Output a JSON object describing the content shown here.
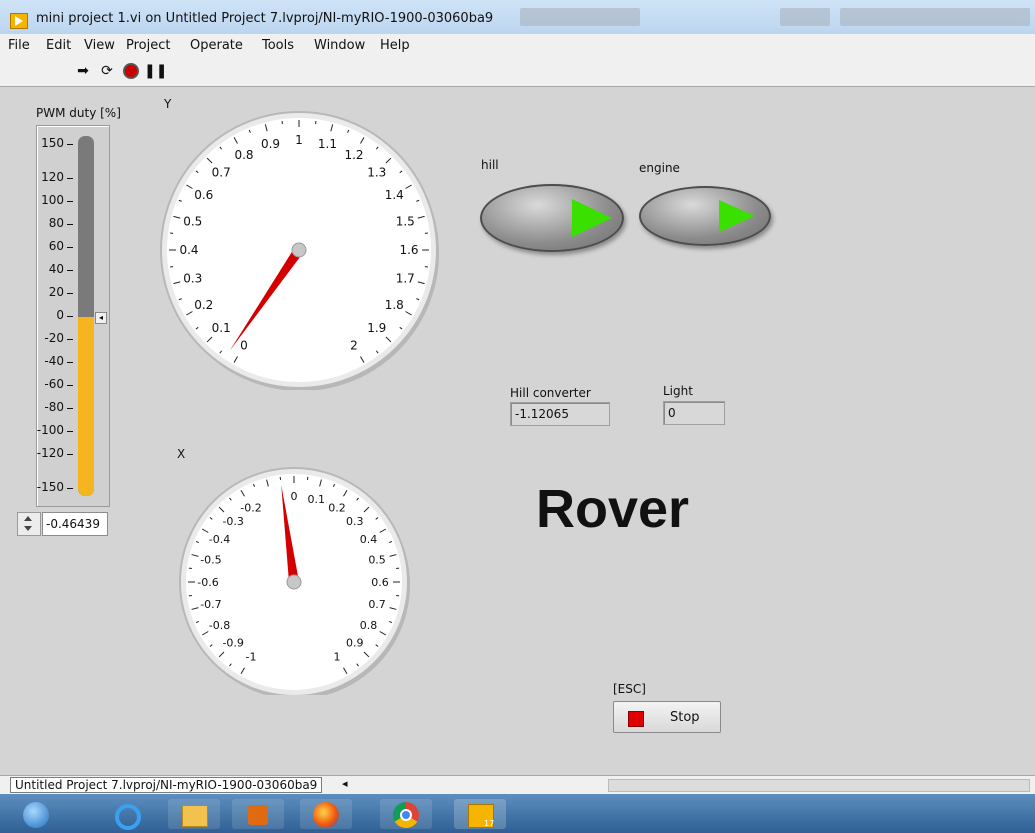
{
  "window": {
    "title": "mini project 1.vi on Untitled Project 7.lvproj/NI-myRIO-1900-03060ba9"
  },
  "menu": [
    "File",
    "Edit",
    "View",
    "Project",
    "Operate",
    "Tools",
    "Window",
    "Help"
  ],
  "toolbar": {
    "icons": [
      "run-arrow-icon",
      "run-continuous-icon",
      "abort-icon",
      "pause-icon"
    ]
  },
  "pwm": {
    "label": "PWM duty  [%]",
    "ticks": [
      "150",
      "120",
      "100",
      "80",
      "60",
      "40",
      "20",
      "0",
      "-20",
      "-40",
      "-60",
      "-80",
      "-100",
      "-120",
      "-150"
    ],
    "value_display": "-0.46439",
    "value": -0.46439,
    "min": -150,
    "max": 150
  },
  "gauge_y": {
    "label": "Y",
    "ticks": [
      "0",
      "0.1",
      "0.2",
      "0.3",
      "0.4",
      "0.5",
      "0.6",
      "0.7",
      "0.8",
      "0.9",
      "1",
      "1.1",
      "1.2",
      "1.3",
      "1.4",
      "1.5",
      "1.6",
      "1.7",
      "1.8",
      "1.9",
      "2"
    ],
    "min": 0,
    "max": 2,
    "value": 0.03
  },
  "gauge_x": {
    "label": "X",
    "ticks": [
      "-1",
      "-0.9",
      "-0.8",
      "-0.7",
      "-0.6",
      "-0.5",
      "-0.4",
      "-0.3",
      "-0.2",
      "0",
      "0.1",
      "0.2",
      "0.3",
      "0.4",
      "0.5",
      "0.6",
      "0.7",
      "0.8",
      "0.9",
      "1"
    ],
    "min": -1,
    "max": 1,
    "value": -0.05
  },
  "leds": {
    "hill": {
      "label": "hill"
    },
    "engine": {
      "label": "engine"
    },
    "on_color": "#39e000"
  },
  "indicators": {
    "hill_converter": {
      "label": "Hill converter",
      "value": "-1.12065"
    },
    "light": {
      "label": "Light",
      "value": "0"
    }
  },
  "title": "Rover",
  "stop": {
    "shortcut": "[ESC]",
    "label": "Stop"
  },
  "status": {
    "path": "Untitled Project 7.lvproj/NI-myRIO-1900-03060ba9",
    "arrow": "◂"
  },
  "taskbar": {
    "items": [
      "start-button",
      "internet-explorer-icon",
      "file-explorer-icon",
      "media-player-icon",
      "firefox-icon",
      "chrome-icon",
      "labview-icon"
    ],
    "labview_badge": "17"
  },
  "colors": {
    "pwm_fill": "#f5b51f",
    "needle": "#d40000",
    "stop": "#e00000"
  }
}
